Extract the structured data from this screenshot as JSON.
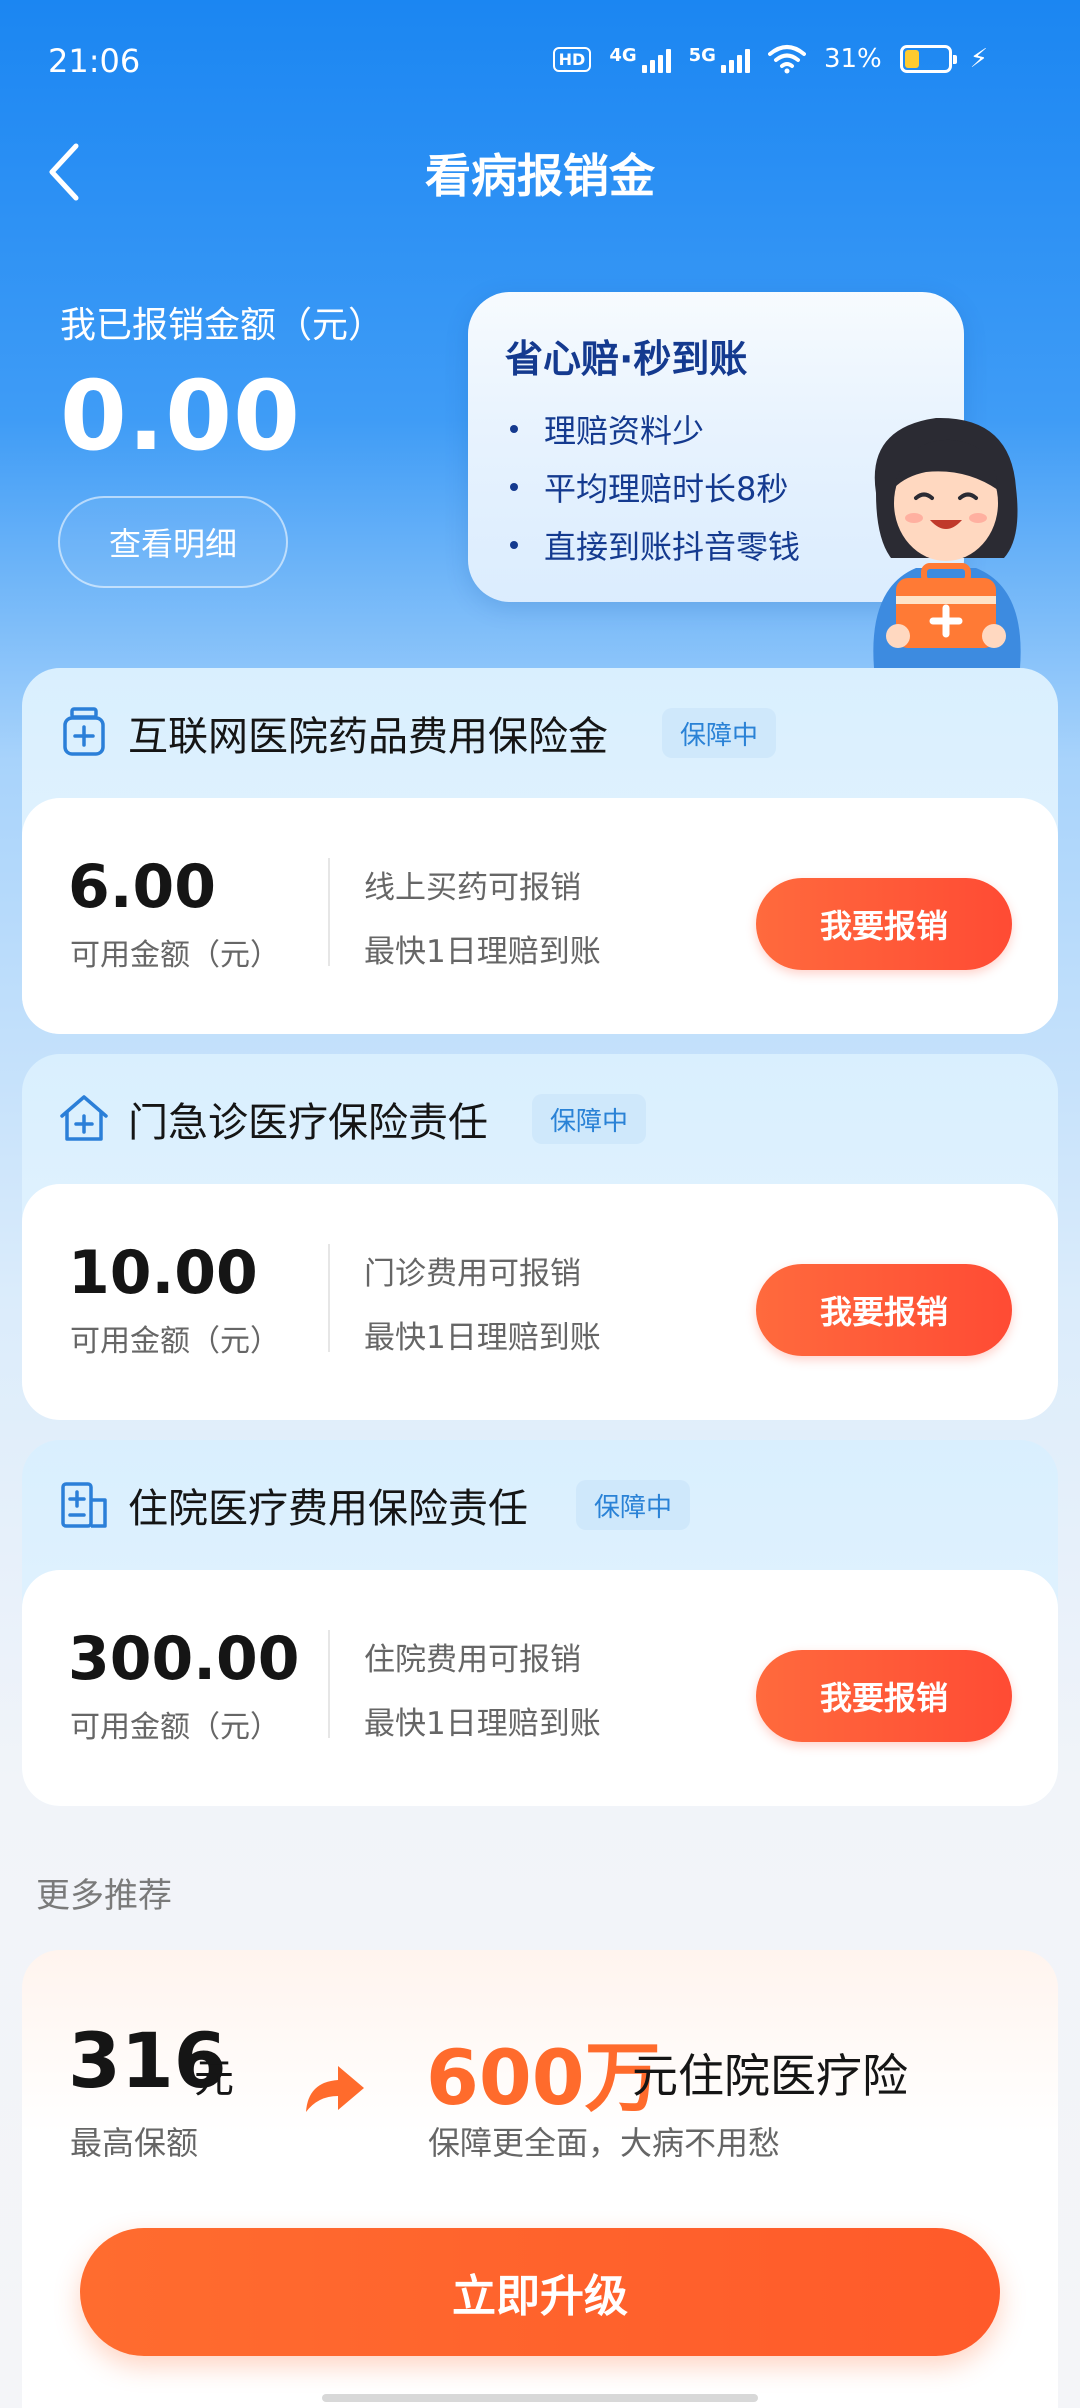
{
  "status_bar": {
    "time": "21:06",
    "hd": "HD",
    "net1": "4G",
    "net2": "5G",
    "battery": "31%"
  },
  "header": {
    "title": "看病报销金"
  },
  "summary": {
    "label": "我已报销金额（元）",
    "amount": "0.00",
    "detail_button": "查看明细"
  },
  "promo": {
    "title": "省心赔·秒到账",
    "items": [
      "理赔资料少",
      "平均理赔时长8秒",
      "直接到账抖音零钱"
    ]
  },
  "cards": [
    {
      "title": "互联网医院药品费用保险金",
      "badge": "保障中",
      "amount": "6.00",
      "amount_label": "可用金额（元）",
      "desc1": "线上买药可报销",
      "desc2": "最快1日理赔到账",
      "button": "我要报销"
    },
    {
      "title": "门急诊医疗保险责任",
      "badge": "保障中",
      "amount": "10.00",
      "amount_label": "可用金额（元）",
      "desc1": "门诊费用可报销",
      "desc2": "最快1日理赔到账",
      "button": "我要报销"
    },
    {
      "title": "住院医疗费用保险责任",
      "badge": "保障中",
      "amount": "300.00",
      "amount_label": "可用金额（元）",
      "desc1": "住院费用可报销",
      "desc2": "最快1日理赔到账",
      "button": "我要报销"
    }
  ],
  "more": {
    "heading": "更多推荐",
    "current_amount": "316",
    "current_unit": "元",
    "current_label": "最高保额",
    "target_amount": "600万",
    "target_suffix": "元住院医疗险",
    "target_desc": "保障更全面，大病不用愁",
    "button": "立即升级"
  },
  "icons": {
    "back": "chevron-left-icon",
    "card1": "medicine-bottle-icon",
    "card2": "clinic-icon",
    "card3": "hospital-building-icon",
    "upgrade_arrow": "arrow-right-icon"
  },
  "colors": {
    "primary_blue": "#1b86f2",
    "accent_orange": "#ff5a2a",
    "badge_blue": "#2a82d6",
    "dark_navy": "#143a8f"
  }
}
